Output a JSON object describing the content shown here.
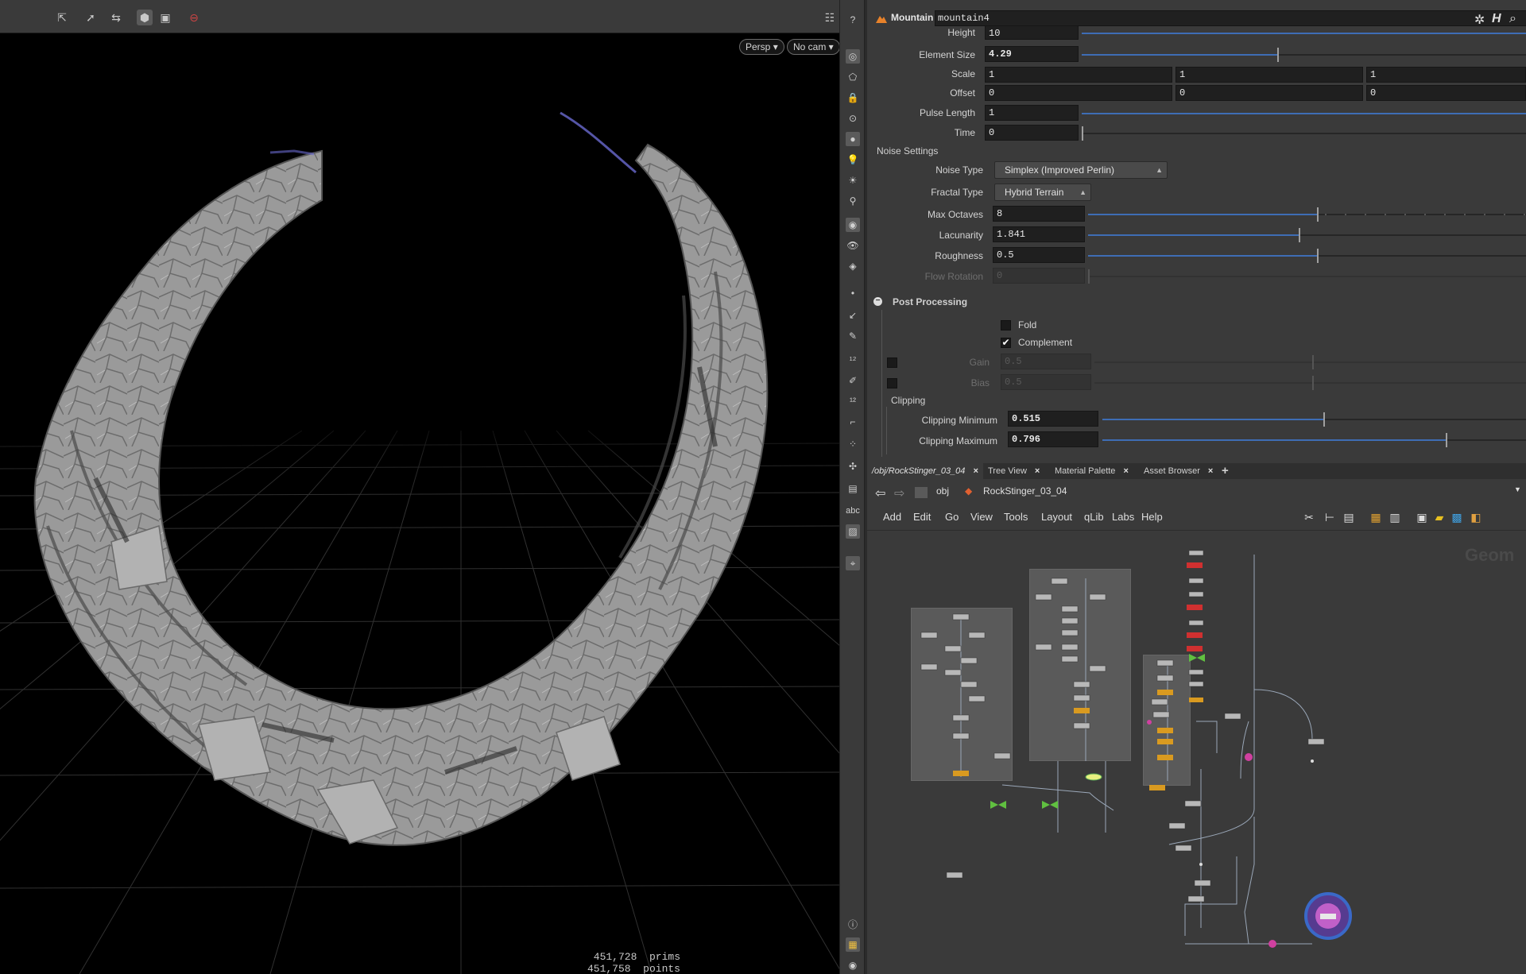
{
  "viewport": {
    "camera_dropdown": "Persp",
    "cam_dropdown": "No cam",
    "stats": [
      "451,728  prims",
      "451,758  points"
    ]
  },
  "params": {
    "node_type": "Mountain",
    "node_name": "mountain4",
    "height": {
      "label": "Height",
      "value": "10"
    },
    "element_size": {
      "label": "Element Size",
      "value": "4.29"
    },
    "scale": {
      "label": "Scale",
      "values": [
        "1",
        "1",
        "1"
      ]
    },
    "offset": {
      "label": "Offset",
      "values": [
        "0",
        "0",
        "0"
      ]
    },
    "pulse_length": {
      "label": "Pulse Length",
      "value": "1"
    },
    "time": {
      "label": "Time",
      "value": "0"
    },
    "noise_settings": "Noise Settings",
    "noise_type": {
      "label": "Noise Type",
      "value": "Simplex (Improved Perlin)"
    },
    "fractal_type": {
      "label": "Fractal Type",
      "value": "Hybrid Terrain"
    },
    "max_octaves": {
      "label": "Max Octaves",
      "value": "8"
    },
    "lacunarity": {
      "label": "Lacunarity",
      "value": "1.841"
    },
    "roughness": {
      "label": "Roughness",
      "value": "0.5"
    },
    "flow_rotation": {
      "label": "Flow Rotation",
      "value": "0"
    },
    "post_processing": "Post Processing",
    "fold": "Fold",
    "complement": "Complement",
    "gain": {
      "label": "Gain",
      "value": "0.5"
    },
    "bias": {
      "label": "Bias",
      "value": "0.5"
    },
    "clipping": "Clipping",
    "clip_min": {
      "label": "Clipping Minimum",
      "value": "0.515"
    },
    "clip_max": {
      "label": "Clipping Maximum",
      "value": "0.796"
    }
  },
  "network": {
    "tabs": [
      "/obj/RockStinger_03_04",
      "Tree View",
      "Material Palette",
      "Asset Browser"
    ],
    "path": [
      "obj",
      "RockStinger_03_04"
    ],
    "menu": [
      "Add",
      "Edit",
      "Go",
      "View",
      "Tools",
      "Layout",
      "qLib",
      "Labs",
      "Help"
    ],
    "context_label": "Geom"
  }
}
